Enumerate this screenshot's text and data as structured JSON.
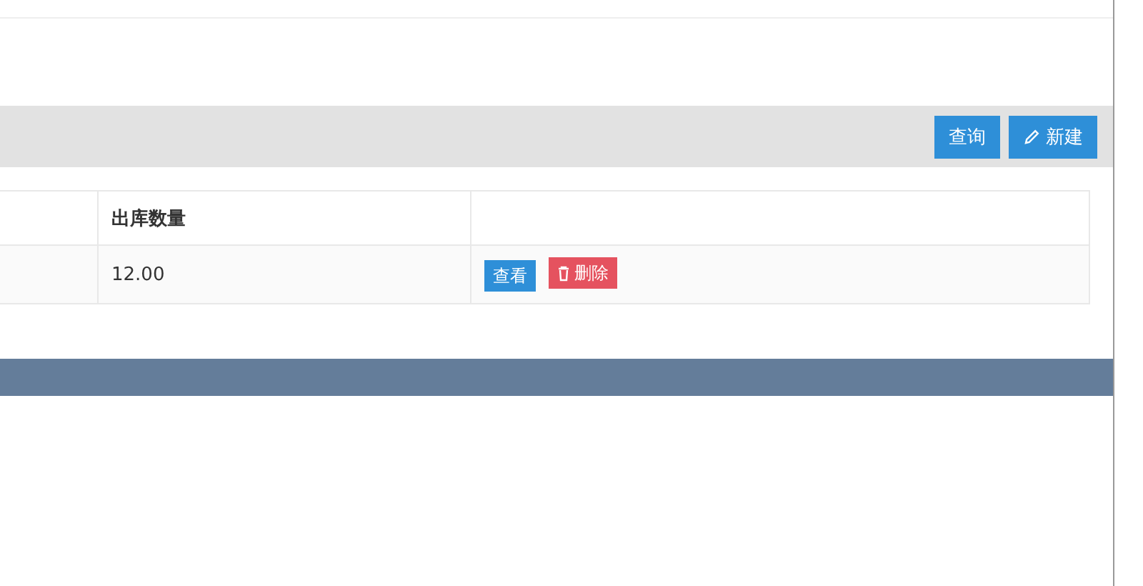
{
  "toolbar": {
    "buttons": [
      {
        "label": "查询",
        "kind": "query"
      },
      {
        "label": "新建",
        "kind": "create"
      }
    ]
  },
  "table": {
    "columns": [
      "出库数量"
    ],
    "rows": [
      {
        "quantity": "12.00",
        "actions": [
          {
            "label": "查看",
            "kind": "view"
          },
          {
            "label": "删除",
            "kind": "delete"
          }
        ]
      }
    ]
  }
}
